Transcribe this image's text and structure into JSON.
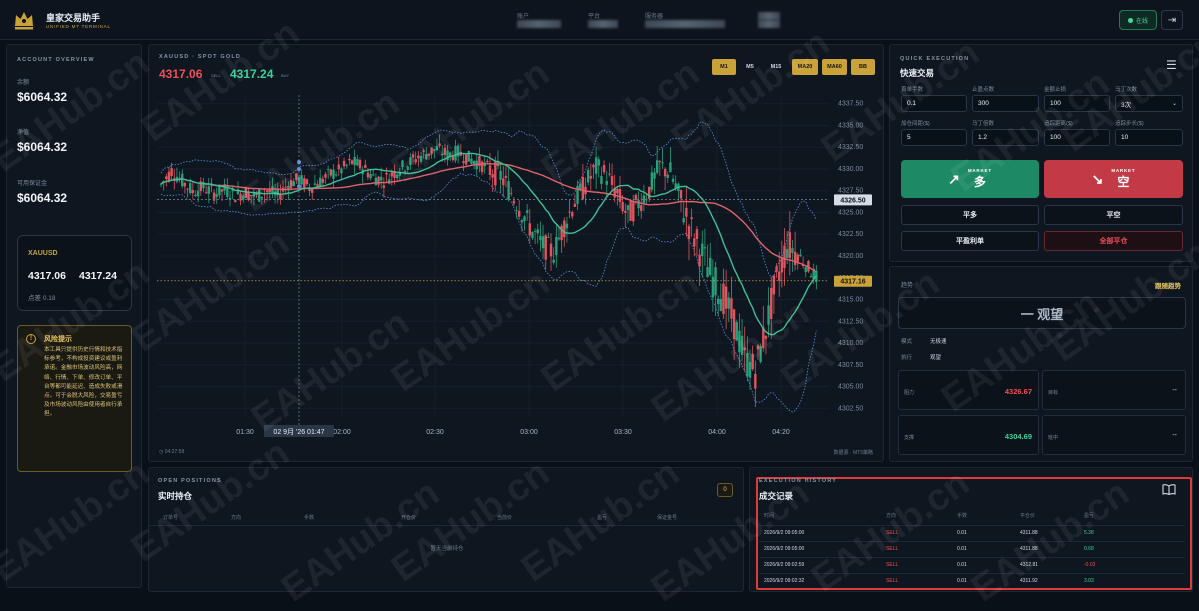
{
  "header": {
    "title": "皇家交易助手",
    "subtitle": "UNIFIED MT TERMINAL",
    "account_label": "账户",
    "platform_label": "平台",
    "server_label": "服务器",
    "online_label": "在线"
  },
  "account": {
    "caption": "ACCOUNT OVERVIEW",
    "balance_label": "余额",
    "balance": "$6064.32",
    "equity_label": "净值",
    "equity": "$6064.32",
    "free_margin_label": "可用保证金",
    "free_margin": "$6064.32",
    "symbol": "XAUUSD",
    "bid": "4317.06",
    "ask": "4317.24",
    "spread_label": "点差",
    "spread": "0.18"
  },
  "risk": {
    "title": "风险提示",
    "text": "本工具只提供历史行情和技术指标参考，不构成投资建议或盈利承诺。金融市场波动风险高，网络、行情、下单、修改订单、平台等都可能延迟、造成失败或滑点。可于会脱大风险，交易盈亏及市场波动风险由使用者自行承担。"
  },
  "chart": {
    "caption": "XAUUSD · SPOT GOLD",
    "sell_price": "4317.06",
    "sell_tag": "SELL",
    "buy_price": "4317.24",
    "buy_tag": "BUY",
    "timeframes": [
      {
        "label": "M1",
        "active": true
      },
      {
        "label": "M5",
        "active": false
      },
      {
        "label": "M15",
        "active": false
      },
      {
        "label": "MA20",
        "active": true
      },
      {
        "label": "MA60",
        "active": true
      },
      {
        "label": "BB",
        "active": true
      }
    ],
    "footer_time": "04:27:58",
    "footer_right": "数据源 · MT5策略",
    "crosshair_label": "02 9月 '26   01:47",
    "crosshair_price": "4326.50",
    "last_price": "4317.16"
  },
  "chart_data": {
    "type": "candlestick",
    "x_ticks": [
      "01:30",
      "02:00",
      "02:30",
      "03:00",
      "03:30",
      "04:00",
      "04:20"
    ],
    "y_ticks": [
      "4337.50",
      "4335.00",
      "4332.50",
      "4330.00",
      "4327.50",
      "4325.00",
      "4322.50",
      "4320.00",
      "4317.50",
      "4315.00",
      "4312.50",
      "4310.00",
      "4307.50",
      "4305.00",
      "4302.50"
    ],
    "ylim": [
      4301.5,
      4338.5
    ],
    "series": [
      {
        "name": "MA20",
        "color": "#3fbf95"
      },
      {
        "name": "MA60",
        "color": "#e0636b"
      },
      {
        "name": "BB",
        "color": "#5f8fd8"
      }
    ],
    "trend_points": [
      4328.2,
      4329.8,
      4328.6,
      4327.4,
      4327.9,
      4327.2,
      4327.6,
      4327.0,
      4327.3,
      4326.8,
      4327.5,
      4326.9,
      4328.3,
      4328.8,
      4327.9,
      4328.6,
      4329.4,
      4329.9,
      4330.8,
      4330.2,
      4329.1,
      4328.7,
      4329.6,
      4330.4,
      4331.2,
      4331.8,
      4332.3,
      4331.6,
      4331.9,
      4331.2,
      4330.7,
      4329.9,
      4329.2,
      4327.3,
      4325.1,
      4322.8,
      4321.2,
      4320.4,
      4323.6,
      4326.3,
      4328.2,
      4330.1,
      4329.2,
      4327.1,
      4324.6,
      4326.1,
      4327.6,
      4330.3,
      4329.6,
      4326.2,
      4322.9,
      4320.1,
      4317.3,
      4315.2,
      4312.4,
      4308.2,
      4306.8,
      4311.7,
      4317.1,
      4321.3,
      4320.2,
      4318.6,
      4317.2
    ]
  },
  "quick": {
    "caption": "QUICK EXECUTION",
    "title": "快速交易",
    "fields": [
      {
        "label": "首单手数",
        "value": "0.1"
      },
      {
        "label": "止盈点数",
        "value": "300"
      },
      {
        "label": "金额止损",
        "value": "100"
      },
      {
        "label": "马丁次数",
        "value": "3次"
      },
      {
        "label": "加仓间距($)",
        "value": "5"
      },
      {
        "label": "马丁倍数",
        "value": "1.2"
      },
      {
        "label": "追踪距离($)",
        "value": "100"
      },
      {
        "label": "追踪步长($)",
        "value": "10"
      }
    ],
    "long_tag": "MARKET",
    "long_label": "多",
    "short_tag": "MARKET",
    "short_label": "空",
    "close_long": "平多",
    "close_short": "平空",
    "close_profit": "平盈利单",
    "close_all": "全部平仓"
  },
  "signal": {
    "trend_label": "趋势",
    "link": "跟随趋势",
    "main": "一 观望",
    "mode_label": "模式",
    "mode": "无极速",
    "exec_label": "执行",
    "exec": "观望",
    "resistance_label": "阻力",
    "resistance": "4326.67",
    "target_label": "目标",
    "target": "--",
    "support_label": "支撑",
    "support": "4304.69",
    "mid_label": "班中",
    "mid": "--"
  },
  "positions": {
    "caption": "OPEN POSITIONS",
    "title": "实时持仓",
    "count": "0",
    "columns": [
      "订单号",
      "方向",
      "手数",
      "开仓价",
      "当前价",
      "盈亏",
      "保证金号"
    ],
    "empty": "暂无当前持仓"
  },
  "history": {
    "caption": "EXECUTION HISTORY",
    "title": "成交记录",
    "columns": [
      "时间",
      "方向",
      "手数",
      "平仓价",
      "盈亏"
    ],
    "rows": [
      {
        "time": "2026/9/2 09:05:00",
        "dir": "SELL",
        "lots": "0.01",
        "price": "4311.88",
        "pnl": "5.38"
      },
      {
        "time": "2026/9/2 09:05:00",
        "dir": "SELL",
        "lots": "0.01",
        "price": "4311.88",
        "pnl": "0.68"
      },
      {
        "time": "2026/9/2 09:02:59",
        "dir": "SELL",
        "lots": "0.01",
        "price": "4312.81",
        "pnl": "-0.03"
      },
      {
        "time": "2026/9/2 09:02:32",
        "dir": "SELL",
        "lots": "0.01",
        "price": "4311.92",
        "pnl": "3.03"
      }
    ]
  },
  "watermark": "EAHub.cn"
}
